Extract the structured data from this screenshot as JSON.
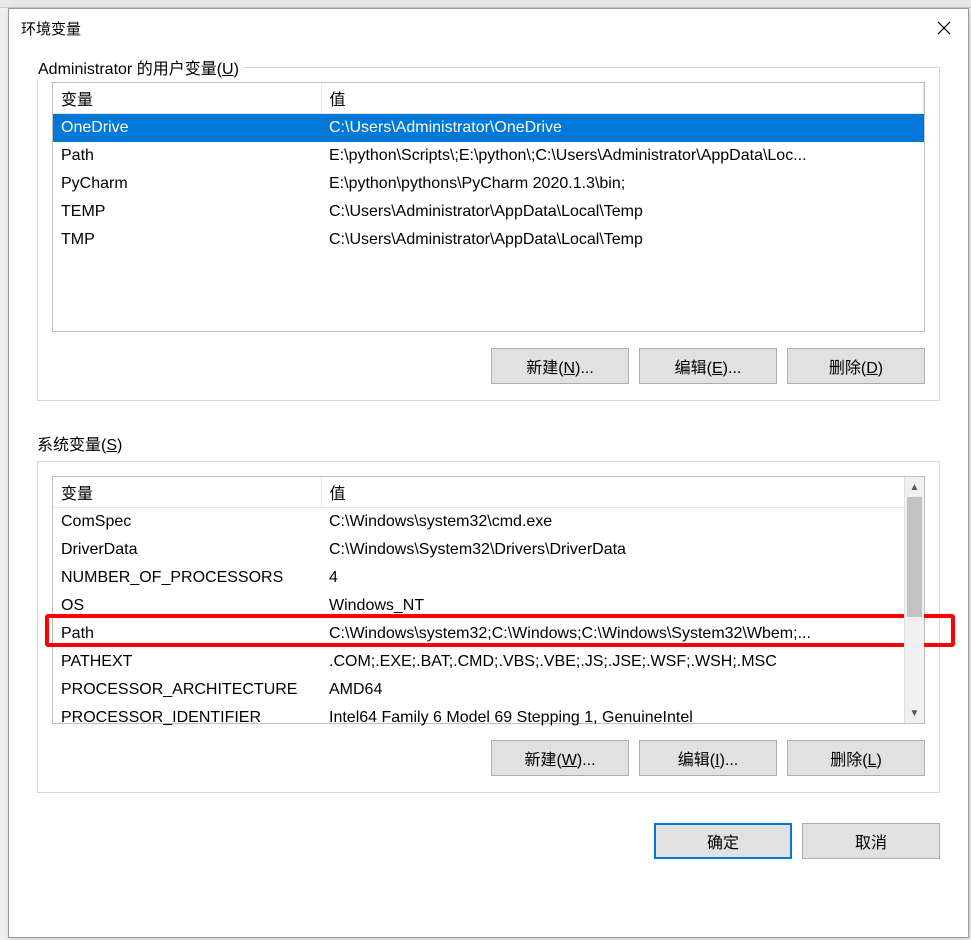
{
  "window": {
    "title": "环境变量"
  },
  "userSection": {
    "legend_prefix": "Administrator 的用户变量(",
    "legend_key": "U",
    "legend_suffix": ")",
    "headers": {
      "var": "变量",
      "val": "值"
    },
    "rows": [
      {
        "var": "OneDrive",
        "val": "C:\\Users\\Administrator\\OneDrive"
      },
      {
        "var": "Path",
        "val": "E:\\python\\Scripts\\;E:\\python\\;C:\\Users\\Administrator\\AppData\\Loc..."
      },
      {
        "var": "PyCharm",
        "val": "E:\\python\\pythons\\PyCharm 2020.1.3\\bin;"
      },
      {
        "var": "TEMP",
        "val": "C:\\Users\\Administrator\\AppData\\Local\\Temp"
      },
      {
        "var": "TMP",
        "val": "C:\\Users\\Administrator\\AppData\\Local\\Temp"
      }
    ],
    "buttons": {
      "new_prefix": "新建(",
      "new_key": "N",
      "new_suffix": ")...",
      "edit_prefix": "编辑(",
      "edit_key": "E",
      "edit_suffix": ")...",
      "del_prefix": "删除(",
      "del_key": "D",
      "del_suffix": ")"
    }
  },
  "systemSection": {
    "label_prefix": "系统变量(",
    "label_key": "S",
    "label_suffix": ")",
    "headers": {
      "var": "变量",
      "val": "值"
    },
    "rows": [
      {
        "var": "ComSpec",
        "val": "C:\\Windows\\system32\\cmd.exe"
      },
      {
        "var": "DriverData",
        "val": "C:\\Windows\\System32\\Drivers\\DriverData"
      },
      {
        "var": "NUMBER_OF_PROCESSORS",
        "val": "4"
      },
      {
        "var": "OS",
        "val": "Windows_NT"
      },
      {
        "var": "Path",
        "val": "C:\\Windows\\system32;C:\\Windows;C:\\Windows\\System32\\Wbem;..."
      },
      {
        "var": "PATHEXT",
        "val": ".COM;.EXE;.BAT;.CMD;.VBS;.VBE;.JS;.JSE;.WSF;.WSH;.MSC"
      },
      {
        "var": "PROCESSOR_ARCHITECTURE",
        "val": "AMD64"
      },
      {
        "var": "PROCESSOR_IDENTIFIER",
        "val": "Intel64 Family 6 Model 69 Stepping 1, GenuineIntel"
      }
    ],
    "buttons": {
      "new_prefix": "新建(",
      "new_key": "W",
      "new_suffix": ")...",
      "edit_prefix": "编辑(",
      "edit_key": "I",
      "edit_suffix": ")...",
      "del_prefix": "删除(",
      "del_key": "L",
      "del_suffix": ")"
    }
  },
  "dialogButtons": {
    "ok": "确定",
    "cancel": "取消"
  }
}
